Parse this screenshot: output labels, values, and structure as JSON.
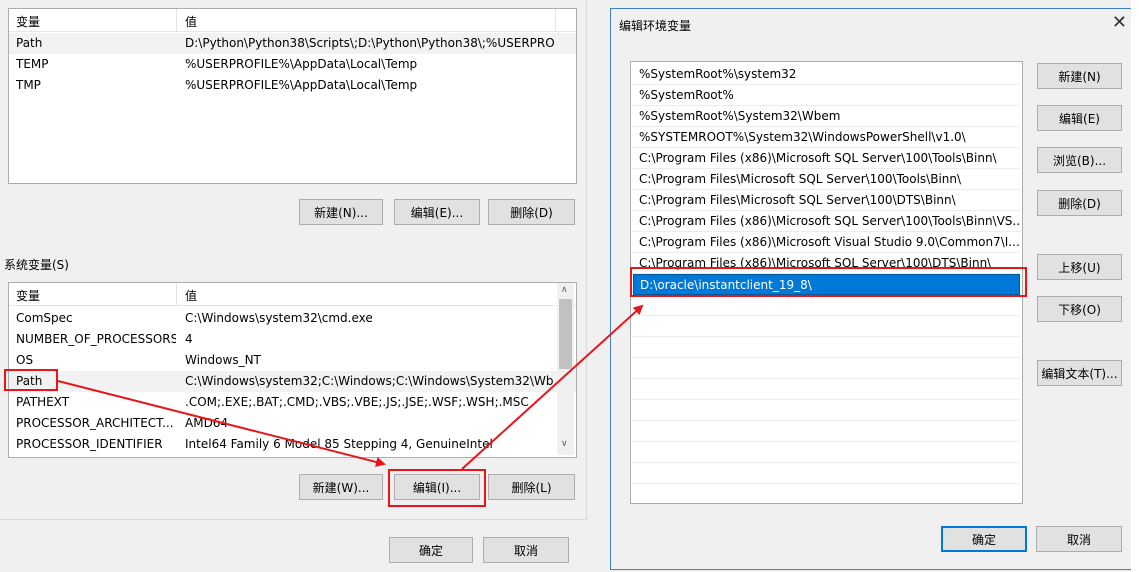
{
  "user_vars": {
    "col_name": "变量",
    "col_value": "值",
    "rows": [
      {
        "name": "Path",
        "value": "D:\\Python\\Python38\\Scripts\\;D:\\Python\\Python38\\;%USERPRO..."
      },
      {
        "name": "TEMP",
        "value": "%USERPROFILE%\\AppData\\Local\\Temp"
      },
      {
        "name": "TMP",
        "value": "%USERPROFILE%\\AppData\\Local\\Temp"
      }
    ],
    "new_btn": "新建(N)...",
    "edit_btn": "编辑(E)...",
    "delete_btn": "删除(D)"
  },
  "system_vars": {
    "label": "系统变量(S)",
    "col_name": "变量",
    "col_value": "值",
    "rows": [
      {
        "name": "ComSpec",
        "value": "C:\\Windows\\system32\\cmd.exe"
      },
      {
        "name": "NUMBER_OF_PROCESSORS",
        "value": "4"
      },
      {
        "name": "OS",
        "value": "Windows_NT"
      },
      {
        "name": "Path",
        "value": "C:\\Windows\\system32;C:\\Windows;C:\\Windows\\System32\\Wb..."
      },
      {
        "name": "PATHEXT",
        "value": ".COM;.EXE;.BAT;.CMD;.VBS;.VBE;.JS;.JSE;.WSF;.WSH;.MSC"
      },
      {
        "name": "PROCESSOR_ARCHITECT...",
        "value": "AMD64"
      },
      {
        "name": "PROCESSOR_IDENTIFIER",
        "value": "Intel64 Family 6 Model 85 Stepping 4, GenuineIntel"
      }
    ],
    "new_btn": "新建(W)...",
    "edit_btn": "编辑(I)...",
    "delete_btn": "删除(L)"
  },
  "main_buttons": {
    "ok": "确定",
    "cancel": "取消"
  },
  "edit_dialog": {
    "title": "编辑环境变量",
    "close": "✕",
    "entries": [
      "%SystemRoot%\\system32",
      "%SystemRoot%",
      "%SystemRoot%\\System32\\Wbem",
      "%SYSTEMROOT%\\System32\\WindowsPowerShell\\v1.0\\",
      "C:\\Program Files (x86)\\Microsoft SQL Server\\100\\Tools\\Binn\\",
      "C:\\Program Files\\Microsoft SQL Server\\100\\Tools\\Binn\\",
      "C:\\Program Files\\Microsoft SQL Server\\100\\DTS\\Binn\\",
      "C:\\Program Files (x86)\\Microsoft SQL Server\\100\\Tools\\Binn\\VS...",
      "C:\\Program Files (x86)\\Microsoft Visual Studio 9.0\\Common7\\I...",
      "C:\\Program Files (x86)\\Microsoft SQL Server\\100\\DTS\\Binn\\",
      "D:\\oracle\\instantclient_19_8\\"
    ],
    "buttons": {
      "new": "新建(N)",
      "edit": "编辑(E)",
      "browse": "浏览(B)...",
      "delete": "删除(D)",
      "move_up": "上移(U)",
      "move_down": "下移(O)",
      "edit_text": "编辑文本(T)...",
      "ok": "确定",
      "cancel": "取消"
    }
  },
  "colors": {
    "selection": "#0078d7",
    "annotation_red": "#e8151b"
  }
}
